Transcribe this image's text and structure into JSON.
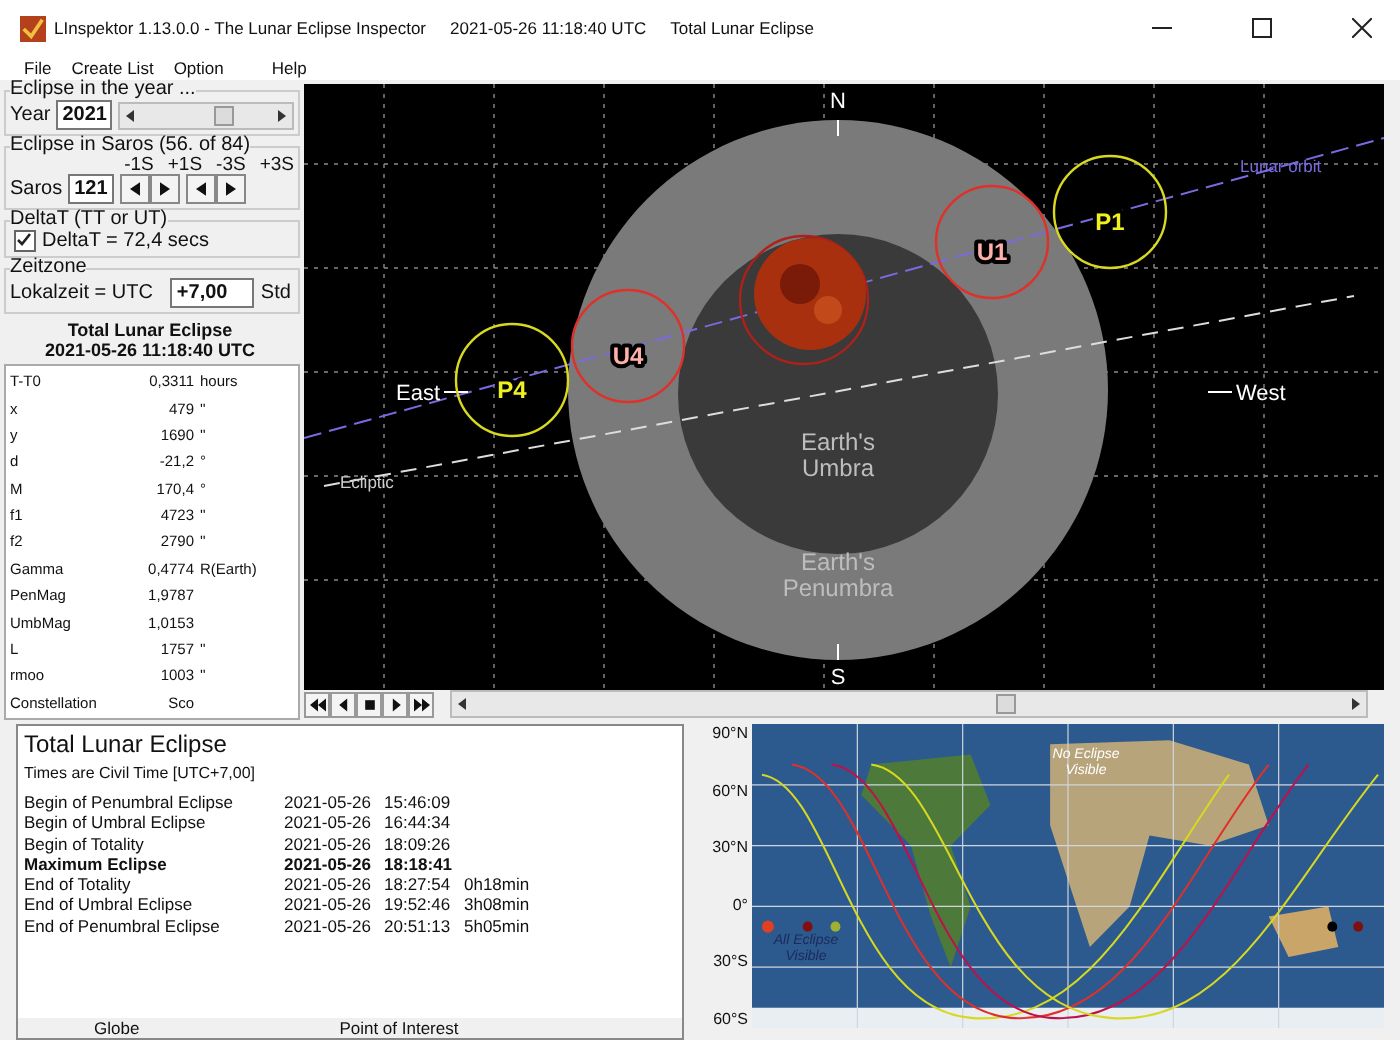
{
  "window": {
    "title": "LInspektor 1.13.0.0 - The Lunar Eclipse Inspector",
    "datetime": "2021-05-26 11:18:40 UTC",
    "eclipse_type": "Total Lunar Eclipse"
  },
  "menu": [
    "File",
    "Create List",
    "Option",
    "Help"
  ],
  "year_group": {
    "title": "Eclipse in the year ...",
    "label": "Year",
    "value": "2021"
  },
  "saros_group": {
    "title": "Eclipse in Saros (56. of 84)",
    "label": "Saros",
    "value": "121",
    "step_labels": [
      "-1S",
      "+1S",
      "-3S",
      "+3S"
    ]
  },
  "deltat_group": {
    "title": "DeltaT (TT or UT)",
    "checkbox": {
      "label": "DeltaT = 72,4 secs",
      "checked": true
    }
  },
  "zone_group": {
    "title": "Zeitzone",
    "label": "Lokalzeit = UTC",
    "value": "+7,00",
    "unit": "Std"
  },
  "summary": {
    "title": "Total Lunar Eclipse",
    "datetime": "2021-05-26  11:18:40 UTC"
  },
  "parameters": [
    {
      "name": "T-T0",
      "value": "0,3311",
      "unit": "hours"
    },
    {
      "name": "x",
      "value": "479",
      "unit": "''"
    },
    {
      "name": "y",
      "value": "1690",
      "unit": "''"
    },
    {
      "name": "d",
      "value": "-21,2",
      "unit": "°"
    },
    {
      "name": "M",
      "value": "170,4",
      "unit": "°"
    },
    {
      "name": "f1",
      "value": "4723",
      "unit": "''"
    },
    {
      "name": "f2",
      "value": "2790",
      "unit": "''"
    },
    {
      "name": "Gamma",
      "value": "0,4774",
      "unit": "R(Earth)"
    },
    {
      "name": "PenMag",
      "value": "1,9787"
    },
    {
      "name": "UmbMag",
      "value": "1,0153"
    },
    {
      "name": "L",
      "value": "1757",
      "unit": "''"
    },
    {
      "name": "rmoo",
      "value": "1003",
      "unit": "''"
    },
    {
      "name": "Constellation",
      "value": "Sco"
    }
  ],
  "diagram": {
    "north": "N",
    "south": "S",
    "east": "East",
    "west": "West",
    "orbit_label": "Lunar orbit",
    "ecliptic_label": "Ecliptic",
    "umbra_label": [
      "Earth's",
      "Umbra"
    ],
    "penumbra_label": [
      "Earth's",
      "Penumbra"
    ],
    "contacts": [
      {
        "label": "P4",
        "kind": "penumbral"
      },
      {
        "label": "U4",
        "kind": "umbral"
      },
      {
        "label": "U1",
        "kind": "umbral"
      },
      {
        "label": "P1",
        "kind": "penumbral"
      }
    ]
  },
  "report": {
    "title": "Total Lunar Eclipse",
    "subtitle": "Times are Civil Time [UTC+7,00]",
    "rows": [
      {
        "event": "Begin of Penumbral Eclipse",
        "date": "2021-05-26",
        "time": "15:46:09",
        "emphasis": false
      },
      {
        "event": "Begin of Umbral Eclipse",
        "date": "2021-05-26",
        "time": "16:44:34",
        "emphasis": false
      },
      {
        "event": "Begin of Totality",
        "date": "2021-05-26",
        "time": "18:09:26",
        "emphasis": false
      },
      {
        "event": "Maximum Eclipse",
        "date": "2021-05-26",
        "time": "18:18:41",
        "emphasis": true
      },
      {
        "event": "End of Totality",
        "date": "2021-05-26",
        "time": "18:27:54",
        "duration": "0h18min",
        "emphasis": false
      },
      {
        "event": "End of Umbral Eclipse",
        "date": "2021-05-26",
        "time": "19:52:46",
        "duration": "3h08min",
        "emphasis": false
      },
      {
        "event": "End of Penumbral Eclipse",
        "date": "2021-05-26",
        "time": "20:51:13",
        "duration": "5h05min",
        "emphasis": false
      }
    ]
  },
  "bottom_groups": [
    "Globe",
    "Point of Interest"
  ],
  "map": {
    "latitudes": [
      "90°N",
      "60°N",
      "30°N",
      "0°",
      "30°S",
      "60°S"
    ],
    "no_eclipse_label": [
      "No",
      "Eclipse",
      "Visible"
    ],
    "all_eclipse_label": [
      "All",
      "Eclipse",
      "Visible"
    ]
  }
}
